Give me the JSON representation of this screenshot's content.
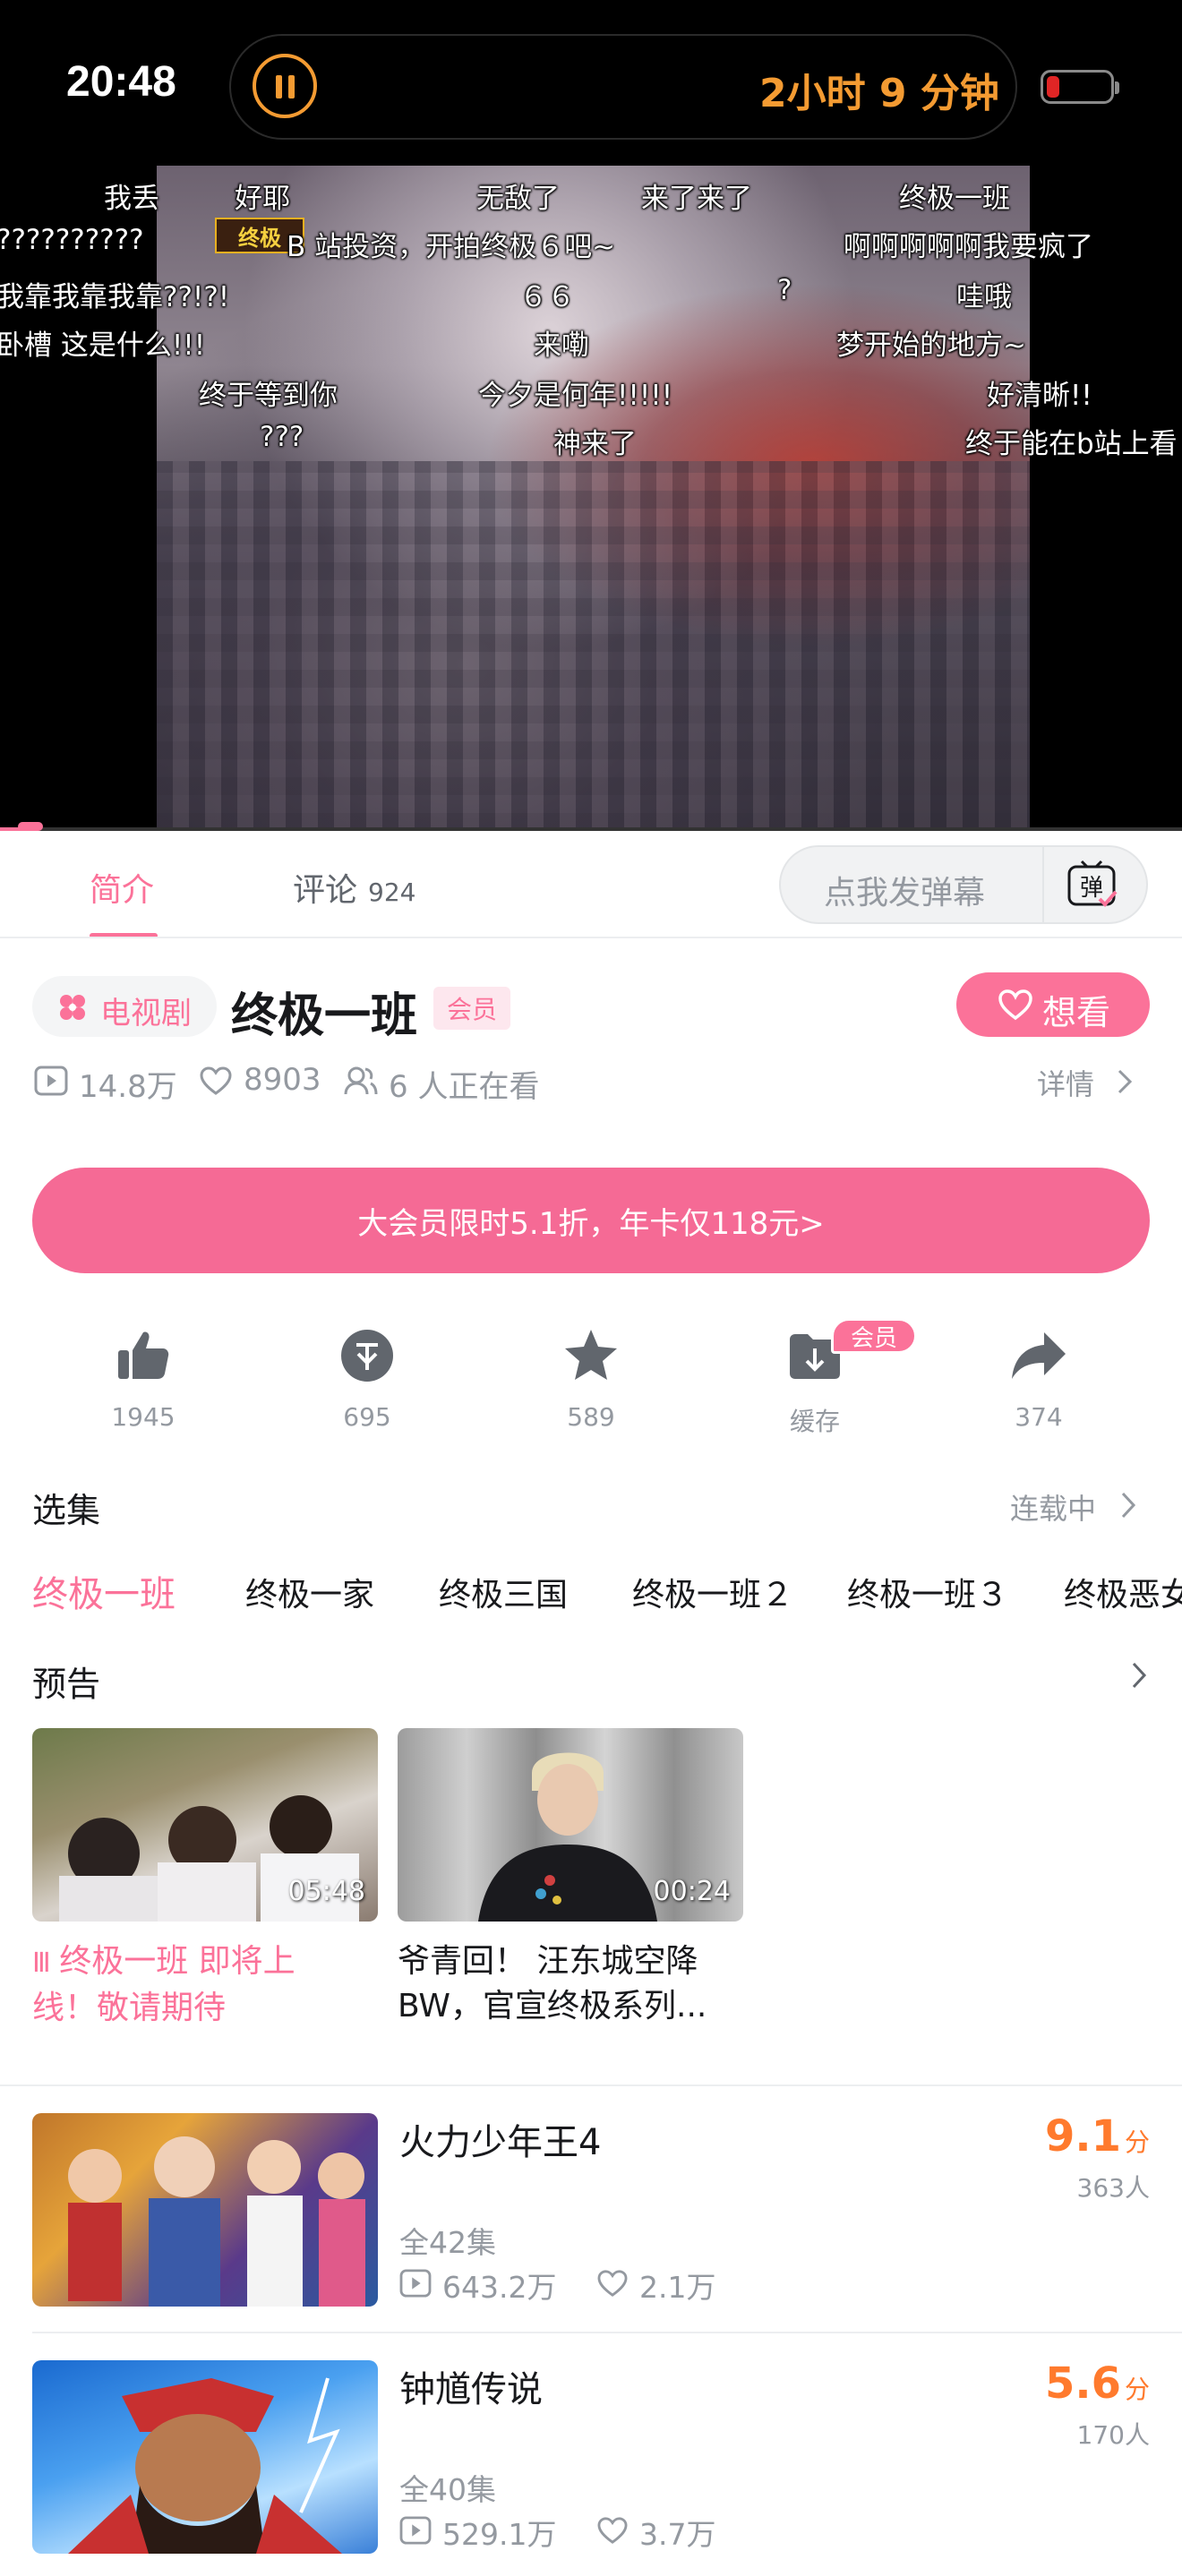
{
  "status_bar": {
    "time": "20:48",
    "timer_text": "2小时 9 分钟"
  },
  "player": {
    "logo_text": "终极",
    "danmaku": [
      "我丢",
      "好耶",
      "无敌了",
      "来了来了",
      "终极一班",
      "??????????",
      "B 站投资，开拍终极６吧~",
      "啊啊啊啊啊我要疯了",
      "我靠我靠我靠??!?!",
      "６６",
      "?",
      "哇哦",
      "卧槽 这是什么!!!",
      "来嘞",
      "梦开始的地方~",
      "终于等到你",
      "今夕是何年!!!!!",
      "好清晰!!",
      "???",
      "神来了",
      "终于能在b站上看"
    ],
    "progress_fraction": 0.03
  },
  "tabs": {
    "intro": "简介",
    "comments": "评论",
    "comments_count": "924",
    "danmaku_placeholder": "点我发弹幕",
    "danmaku_icon_label": "弹"
  },
  "show": {
    "category": "电视剧",
    "title": "终极一班",
    "vip_badge": "会员",
    "want_button": "想看",
    "views": "14.8万",
    "likes": "8903",
    "watching": "6 人正在看",
    "detail": "详情"
  },
  "promo": {
    "text": "大会员限时5.1折，年卡仅118元>"
  },
  "actions": {
    "like": "1945",
    "coin": "695",
    "favorite": "589",
    "cache": "缓存",
    "cache_badge": "会员",
    "share": "374"
  },
  "episodes": {
    "title": "选集",
    "status": "连载中",
    "seasons": [
      "终极一班",
      "终极一家",
      "终极三国",
      "终极一班２",
      "终极一班３",
      "终极恶女"
    ]
  },
  "trailers": {
    "title": "预告",
    "items": [
      {
        "duration": "05:48",
        "title_line1": "终极一班 即将上",
        "title_line2": "线！敬请期待"
      },
      {
        "duration": "00:24",
        "title_line1": "爷青回！ 汪东城空降",
        "title_line2": "BW，官宣终极系列..."
      }
    ]
  },
  "recommendations": [
    {
      "title": "火力少年王4",
      "episodes": "全42集",
      "views": "643.2万",
      "likes": "2.1万",
      "score": "9.1",
      "score_unit": "分",
      "raters": "363人"
    },
    {
      "title": "钟馗传说",
      "episodes": "全40集",
      "views": "529.1万",
      "likes": "3.7万",
      "score": "5.6",
      "score_unit": "分",
      "raters": "170人"
    }
  ],
  "colors": {
    "accent": "#fb7299",
    "score": "#ff7a2d",
    "island_text": "#f49b32"
  }
}
